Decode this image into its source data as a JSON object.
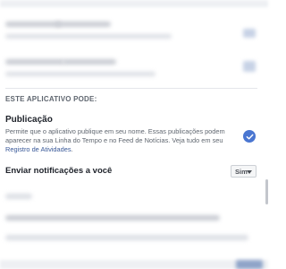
{
  "permissions": {
    "header": "ESTE APLICATIVO PODE:",
    "publication": {
      "title": "Publicação",
      "description_start": "Permite que o aplicativo publique em seu nome. Essas publicações podem aparecer na sua Linha do Tempo e no Feed de Notícias. Veja tudo em seu ",
      "activity_link": "Registro de Atividades",
      "description_end": ".",
      "checked": true,
      "check_icon": "check-circle-icon"
    },
    "notifications": {
      "label": "Enviar notificações a você",
      "selected": "Sim",
      "dropdown_icon": "caret-down-icon"
    }
  },
  "colors": {
    "accent": "#4a76d1",
    "link": "#385898"
  }
}
